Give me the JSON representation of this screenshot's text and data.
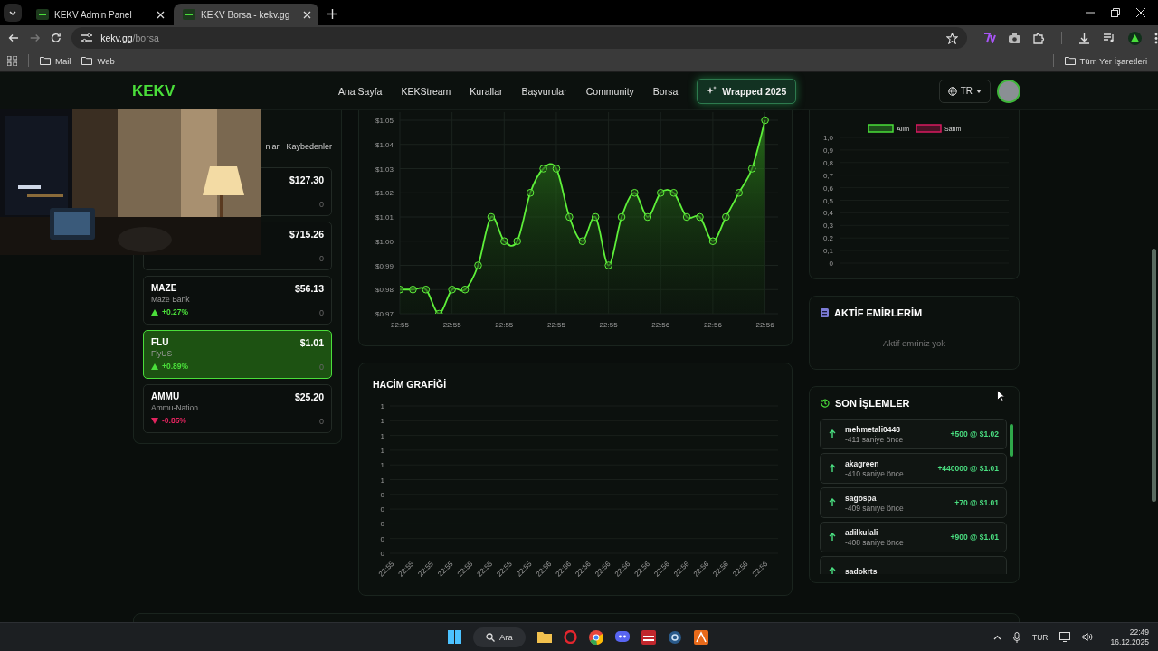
{
  "browser": {
    "tabs": [
      {
        "title": "KEKV Admin Panel",
        "selected": false
      },
      {
        "title": "KEKV Borsa - kekv.gg",
        "selected": true
      }
    ],
    "address": {
      "host": "kekv.gg",
      "path": "/borsa"
    },
    "bookmarks": [
      {
        "label": "Mail"
      },
      {
        "label": "Web"
      }
    ],
    "all_bookmarks": "Tüm Yer İşaretleri"
  },
  "header": {
    "logo": "KEKV",
    "nav": [
      "Ana Sayfa",
      "KEKStream",
      "Kurallar",
      "Başvurular",
      "Community",
      "Borsa"
    ],
    "wrapped_button": "Wrapped 2025",
    "language": "TR"
  },
  "stock_tabs": [
    {
      "label": "nlar"
    },
    {
      "label": "Kaybedenler"
    }
  ],
  "stocks": [
    {
      "price": "$127.30",
      "count": "0",
      "selected": false
    },
    {
      "price": "$715.26",
      "count": "0",
      "selected": false
    },
    {
      "symbol": "MAZE",
      "name": "Maze Bank",
      "change": "+0.27%",
      "kind": "up",
      "price": "$56.13",
      "count": "0",
      "selected": false
    },
    {
      "symbol": "FLU",
      "name": "FlyUS",
      "change": "+0.89%",
      "kind": "up",
      "price": "$1.01",
      "count": "0",
      "selected": true
    },
    {
      "symbol": "AMMU",
      "name": "Ammu-Nation",
      "change": "-0.85%",
      "kind": "down",
      "price": "$25.20",
      "count": "0",
      "selected": false
    }
  ],
  "price_chart": {
    "chart_data": {
      "type": "area",
      "grid": true,
      "categories": [
        "22:55",
        null,
        null,
        null,
        "22:55",
        null,
        null,
        null,
        "22:55",
        null,
        null,
        null,
        "22:55",
        null,
        null,
        null,
        "22:55",
        null,
        null,
        null,
        "22:56",
        null,
        null,
        null,
        "22:56",
        null,
        null,
        null,
        "22:56",
        null
      ],
      "values": [
        0.98,
        0.98,
        0.98,
        0.97,
        0.98,
        0.98,
        0.99,
        1.01,
        1.0,
        1.0,
        1.02,
        1.03,
        1.03,
        1.01,
        1.0,
        1.01,
        0.99,
        1.01,
        1.02,
        1.01,
        1.02,
        1.02,
        1.01,
        1.01,
        1.0,
        1.01,
        1.02,
        1.03,
        1.05,
        null
      ],
      "ylim": [
        0.97,
        1.05
      ],
      "yticks": [
        {
          "value": 0.97,
          "label": "$0.97"
        },
        {
          "value": 0.98,
          "label": "$0.98"
        },
        {
          "value": 0.99,
          "label": "$0.99"
        },
        {
          "value": 1.0,
          "label": "$1.00"
        },
        {
          "value": 1.01,
          "label": "$1.01"
        },
        {
          "value": 1.02,
          "label": "$1.02"
        },
        {
          "value": 1.03,
          "label": "$1.03"
        },
        {
          "value": 1.04,
          "label": "$1.04"
        },
        {
          "value": 1.05,
          "label": "$1.05"
        }
      ]
    }
  },
  "volume_chart": {
    "title": "HACİM GRAFİĞİ",
    "chart_data": {
      "type": "bar",
      "grid": true,
      "categories": [
        "22:55",
        "22:55",
        "22:55",
        "22:55",
        "22:55",
        "22:55",
        "22:55",
        "22:55",
        "22:56",
        "22:56",
        "22:56",
        "22:56",
        "22:56",
        "22:56",
        "22:56",
        "22:56",
        "22:56",
        "22:56",
        "22:56",
        "22:56"
      ],
      "values": [
        0,
        0,
        0,
        0,
        0,
        0,
        0,
        0,
        0,
        0,
        0,
        0,
        0,
        0,
        0,
        0,
        0,
        0,
        0,
        0
      ],
      "ylim": [
        0,
        1
      ],
      "yticks": [
        {
          "value": 1,
          "label": "1"
        },
        {
          "value": 0.9,
          "label": "1"
        },
        {
          "value": 0.8,
          "label": "1"
        },
        {
          "value": 0.7,
          "label": "1"
        },
        {
          "value": 0.6,
          "label": "1"
        },
        {
          "value": 0.5,
          "label": "1"
        },
        {
          "value": 0.4,
          "label": "0"
        },
        {
          "value": 0.3,
          "label": "0"
        },
        {
          "value": 0.2,
          "label": "0"
        },
        {
          "value": 0.1,
          "label": "0"
        },
        {
          "value": 0,
          "label": "0"
        }
      ]
    }
  },
  "depth_chart": {
    "chart_data": {
      "type": "bar",
      "grid": true,
      "series": [
        {
          "name": "Alım",
          "color": "#4ade3a"
        },
        {
          "name": "Satım",
          "color": "#d81b60"
        }
      ],
      "ylim": [
        0,
        1
      ],
      "yticks": [
        {
          "value": 1,
          "label": "1,0"
        },
        {
          "value": 0.9,
          "label": "0,9"
        },
        {
          "value": 0.8,
          "label": "0,8"
        },
        {
          "value": 0.7,
          "label": "0,7"
        },
        {
          "value": 0.6,
          "label": "0,6"
        },
        {
          "value": 0.5,
          "label": "0,5"
        },
        {
          "value": 0.4,
          "label": "0,4"
        },
        {
          "value": 0.3,
          "label": "0,3"
        },
        {
          "value": 0.2,
          "label": "0,2"
        },
        {
          "value": 0.1,
          "label": "0,1"
        },
        {
          "value": 0,
          "label": "0"
        }
      ]
    }
  },
  "active_orders": {
    "title": "AKTİF EMİRLERİM",
    "empty_text": "Aktif emriniz yok"
  },
  "recent_trades": {
    "title": "SON İŞLEMLER",
    "trades": [
      {
        "user": "mehmetali0448",
        "time": "-411 saniye önce",
        "amount": "+500 @ $1.02",
        "kind": "buy"
      },
      {
        "user": "akagreen",
        "time": "-410 saniye önce",
        "amount": "+440000 @ $1.01",
        "kind": "buy"
      },
      {
        "user": "sagospa",
        "time": "-409 saniye önce",
        "amount": "+70 @ $1.01",
        "kind": "buy"
      },
      {
        "user": "adilkulali",
        "time": "-408 saniye önce",
        "amount": "+900 @ $1.01",
        "kind": "buy"
      },
      {
        "user": "sadokrts",
        "kind": "buy"
      }
    ]
  },
  "taskbar": {
    "search": "Ara",
    "language": "TUR",
    "time": "22:49",
    "date": "16.12.2025"
  }
}
